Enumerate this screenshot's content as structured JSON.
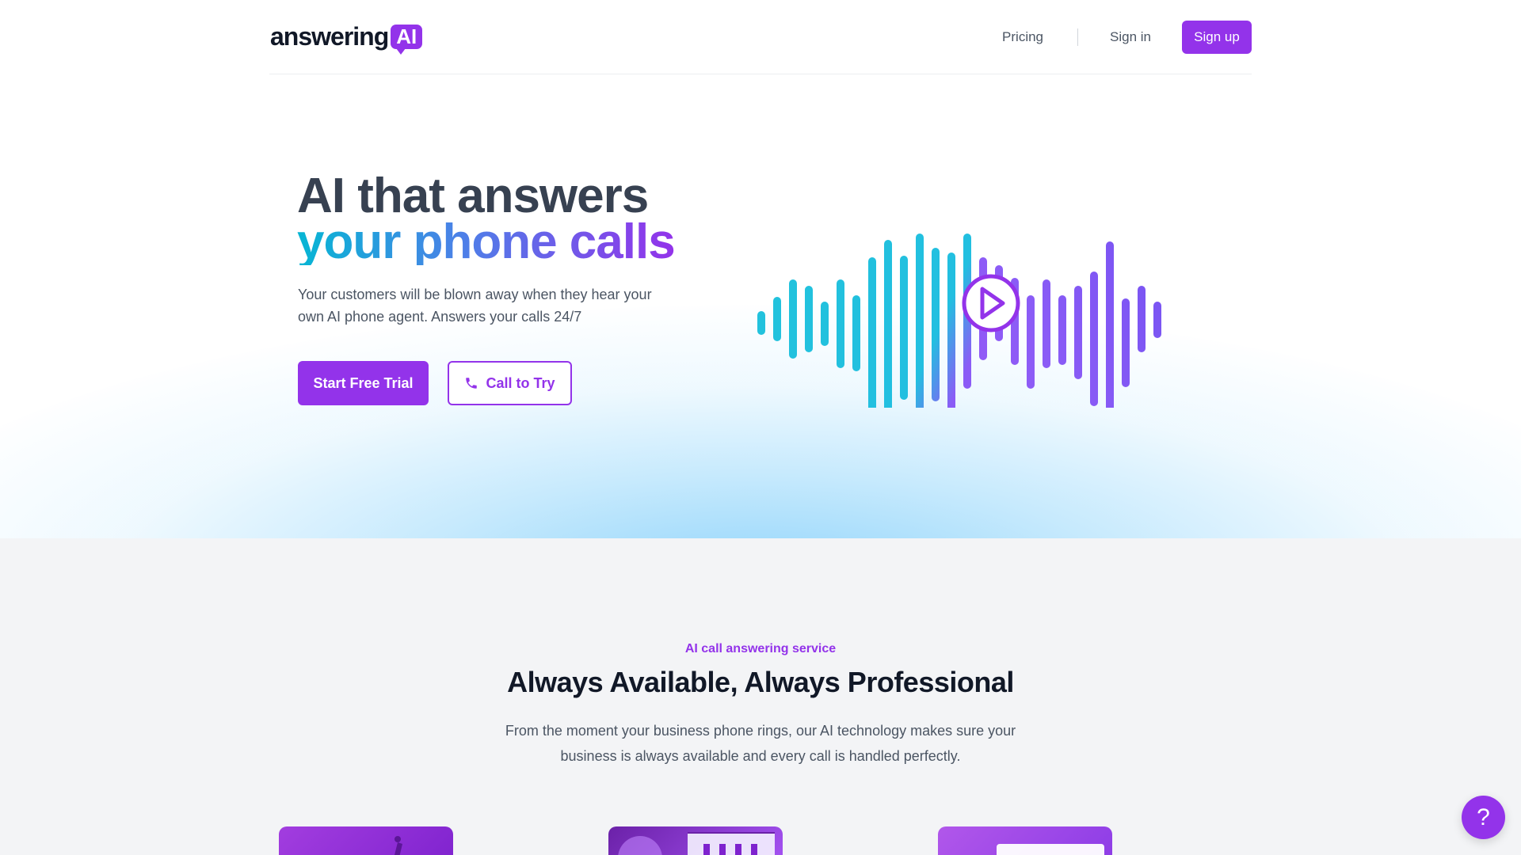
{
  "brand": {
    "logo_word": "answering",
    "logo_badge": "AI"
  },
  "nav": {
    "pricing": "Pricing",
    "sign_in": "Sign in",
    "sign_up": "Sign up"
  },
  "hero": {
    "title_line1": "AI that answers",
    "title_line2": "your phone calls",
    "subtitle": "Your customers will be blown away when they hear your own AI phone agent. Answers your calls 24/7",
    "primary_cta": "Start Free Trial",
    "secondary_cta": "Call to Try",
    "secondary_icon": "phone-icon",
    "media_icon": "play-icon"
  },
  "features": {
    "eyebrow": "AI call answering service",
    "title": "Always Available, Always Professional",
    "subtitle": "From the moment your business phone rings, our AI technology makes sure your business is always available and every call is handled perfectly."
  },
  "help": {
    "label": "?",
    "icon": "help-icon"
  },
  "colors": {
    "accent": "#9333ea",
    "cyan": "#06b6d4",
    "blue": "#4f7ee8",
    "text_dark": "#111827",
    "text_body": "#4b5563",
    "section_bg": "#f3f4f6"
  }
}
